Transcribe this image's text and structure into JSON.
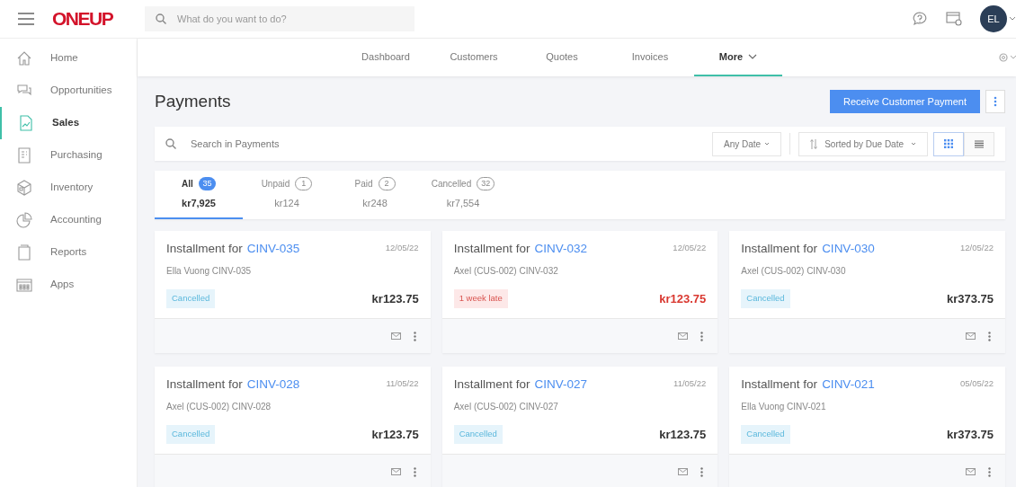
{
  "header": {
    "logo": "ONEUP",
    "search_placeholder": "What do you want to do?",
    "avatar": "EL"
  },
  "sidebar": {
    "items": [
      {
        "label": "Home",
        "selected": false
      },
      {
        "label": "Opportunities",
        "selected": false
      },
      {
        "label": "Sales",
        "selected": true
      },
      {
        "label": "Purchasing",
        "selected": false
      },
      {
        "label": "Inventory",
        "selected": false
      },
      {
        "label": "Accounting",
        "selected": false
      },
      {
        "label": "Reports",
        "selected": false
      },
      {
        "label": "Apps",
        "selected": false
      }
    ]
  },
  "nav": {
    "items": [
      {
        "label": "Dashboard",
        "selected": false,
        "dropdown": false
      },
      {
        "label": "Customers",
        "selected": false,
        "dropdown": false
      },
      {
        "label": "Quotes",
        "selected": false,
        "dropdown": false
      },
      {
        "label": "Invoices",
        "selected": false,
        "dropdown": false
      },
      {
        "label": "More",
        "selected": true,
        "dropdown": true
      }
    ]
  },
  "page": {
    "title": "Payments",
    "primary_button": "Receive Customer Payment"
  },
  "toolbar": {
    "search_placeholder": "Search in Payments",
    "date_filter": "Any Date",
    "sort": "Sorted by Due Date",
    "views": [
      {
        "kind": "grid",
        "selected": true
      },
      {
        "kind": "list",
        "selected": false
      }
    ]
  },
  "filter_tabs": [
    {
      "label": "All",
      "count": "35",
      "total": "kr7,925",
      "selected": true
    },
    {
      "label": "Unpaid",
      "count": "1",
      "total": "kr124",
      "selected": false
    },
    {
      "label": "Paid",
      "count": "2",
      "total": "kr248",
      "selected": false
    },
    {
      "label": "Cancelled",
      "count": "32",
      "total": "kr7,554",
      "selected": false
    }
  ],
  "cards": [
    {
      "title": "Installment for",
      "invoice": "CINV-035",
      "date": "12/05/22",
      "subtitle": "Ella Vuong CINV-035",
      "status": "Cancelled",
      "kind": "cancelled",
      "amount": "kr123.75"
    },
    {
      "title": "Installment for",
      "invoice": "CINV-032",
      "date": "12/05/22",
      "subtitle": "Axel (CUS-002) CINV-032",
      "status": "1 week late",
      "kind": "late",
      "amount": "kr123.75"
    },
    {
      "title": "Installment for",
      "invoice": "CINV-030",
      "date": "12/05/22",
      "subtitle": "Axel (CUS-002) CINV-030",
      "status": "Cancelled",
      "kind": "cancelled",
      "amount": "kr373.75"
    },
    {
      "title": "Installment for",
      "invoice": "CINV-028",
      "date": "11/05/22",
      "subtitle": "Axel (CUS-002) CINV-028",
      "status": "Cancelled",
      "kind": "cancelled",
      "amount": "kr123.75"
    },
    {
      "title": "Installment for",
      "invoice": "CINV-027",
      "date": "11/05/22",
      "subtitle": "Axel (CUS-002) CINV-027",
      "status": "Cancelled",
      "kind": "cancelled",
      "amount": "kr123.75"
    },
    {
      "title": "Installment for",
      "invoice": "CINV-021",
      "date": "05/05/22",
      "subtitle": "Ella Vuong CINV-021",
      "status": "Cancelled",
      "kind": "cancelled",
      "amount": "kr373.75"
    }
  ]
}
